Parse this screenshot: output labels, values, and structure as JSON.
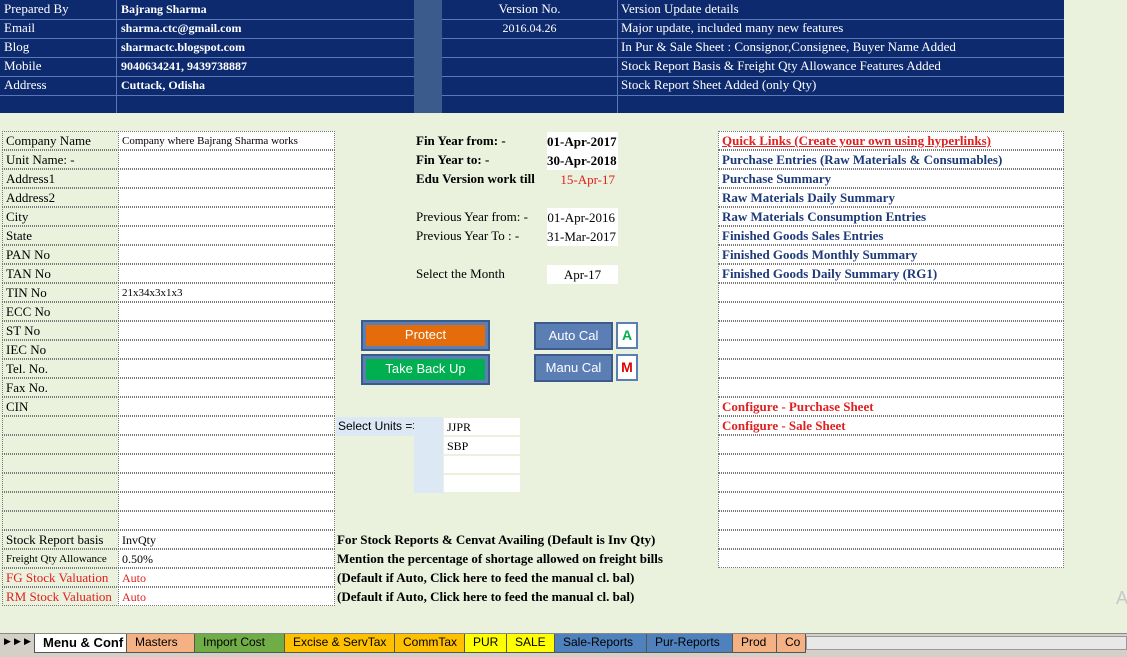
{
  "header": {
    "rows": [
      {
        "label": "Prepared By",
        "value": "Bajrang Sharma"
      },
      {
        "label": "Email",
        "value": "sharma.ctc@gmail.com"
      },
      {
        "label": "Blog",
        "value": "sharmactc.blogspot.com"
      },
      {
        "label": "Mobile",
        "value": "9040634241, 9439738887"
      },
      {
        "label": "Address",
        "value": "Cuttack, Odisha"
      }
    ],
    "version_label": "Version No.",
    "version_value": "2016.04.26",
    "update_title": "Version Update details",
    "updates": [
      "Major update, included many new features",
      "In Pur & Sale Sheet : Consignor,Consignee, Buyer Name Added",
      "Stock Report Basis & Freight Qty Allowance Features Added",
      "Stock Report Sheet Added (only Qty)"
    ]
  },
  "company": {
    "fields": [
      {
        "label": "Company Name",
        "value": "Company where Bajrang Sharma works"
      },
      {
        "label": "Unit Name: -",
        "value": ""
      },
      {
        "label": "Address1",
        "value": ""
      },
      {
        "label": "Address2",
        "value": ""
      },
      {
        "label": "City",
        "value": ""
      },
      {
        "label": "State",
        "value": ""
      },
      {
        "label": "PAN No",
        "value": ""
      },
      {
        "label": "TAN No",
        "value": ""
      },
      {
        "label": "TIN No",
        "value": "21x34x3x1x3"
      },
      {
        "label": "ECC No",
        "value": ""
      },
      {
        "label": "ST No",
        "value": ""
      },
      {
        "label": "IEC No",
        "value": ""
      },
      {
        "label": "Tel. No.",
        "value": ""
      },
      {
        "label": "Fax No.",
        "value": ""
      },
      {
        "label": "CIN",
        "value": ""
      }
    ]
  },
  "settings": [
    {
      "label": "Stock Report basis",
      "value": "InvQty",
      "note": "For Stock Reports & Cenvat Availing (Default is Inv Qty)"
    },
    {
      "label": "Freight Qty Allowance",
      "value": "0.50%",
      "note": "Mention the percentage of shortage allowed on freight bills"
    },
    {
      "label": "FG Stock Valuation",
      "value": "Auto",
      "note": "(Default if Auto, Click here to feed the manual cl. bal)"
    },
    {
      "label": "RM Stock Valuation",
      "value": "Auto",
      "note": "(Default if Auto, Click here to feed the manual cl. bal)"
    }
  ],
  "finyear": {
    "from_label": "Fin Year from: -",
    "from_value": "01-Apr-2017",
    "to_label": "Fin Year to: -",
    "to_value": "30-Apr-2018",
    "edu_label": "Edu Version work till",
    "edu_value": "15-Apr-17",
    "prev_from_label": "Previous Year from: -",
    "prev_from_value": "01-Apr-2016",
    "prev_to_label": "Previous Year To : -",
    "prev_to_value": "31-Mar-2017",
    "month_label": "Select the Month",
    "month_value": "Apr-17"
  },
  "buttons": {
    "protect": "Protect",
    "backup": "Take Back Up",
    "auto_cal": "Auto Cal",
    "manu_cal": "Manu Cal",
    "auto_letter": "A",
    "manu_letter": "M"
  },
  "units": {
    "label": "Select Units =>",
    "items": [
      "JJPR",
      "SBP",
      "",
      ""
    ]
  },
  "quicklinks": {
    "title": "Quick Links (Create your own using hyperlinks)",
    "links": [
      "Purchase Entries (Raw Materials & Consumables)",
      "Purchase Summary",
      "Raw Materials Daily Summary",
      "Raw Materials Consumption Entries",
      "Finished Goods Sales Entries",
      "Finished Goods Monthly Summary",
      "Finished Goods Daily Summary (RG1)"
    ],
    "configure": [
      "Configure - Purchase Sheet",
      "Configure - Sale Sheet"
    ]
  },
  "tabs": [
    {
      "label": "Menu & Conf",
      "color": "#ffffff"
    },
    {
      "label": "Masters",
      "color": "#f4b183"
    },
    {
      "label": "Import Cost",
      "color": "#70ad47"
    },
    {
      "label": "Excise & ServTax",
      "color": "#ffc000"
    },
    {
      "label": "CommTax",
      "color": "#ffc000"
    },
    {
      "label": "PUR",
      "color": "#ffff00"
    },
    {
      "label": "SALE",
      "color": "#ffff00"
    },
    {
      "label": "Sale-Reports",
      "color": "#4f81bd"
    },
    {
      "label": "Pur-Reports",
      "color": "#4f81bd"
    },
    {
      "label": "Prod",
      "color": "#f4b183"
    },
    {
      "label": "Co",
      "color": "#f4b183"
    }
  ],
  "colors": {
    "header_bg": "#0d2a6e",
    "sheet_bg": "#eaf1dd",
    "protect": "#e46c0a",
    "backup": "#00b050"
  }
}
